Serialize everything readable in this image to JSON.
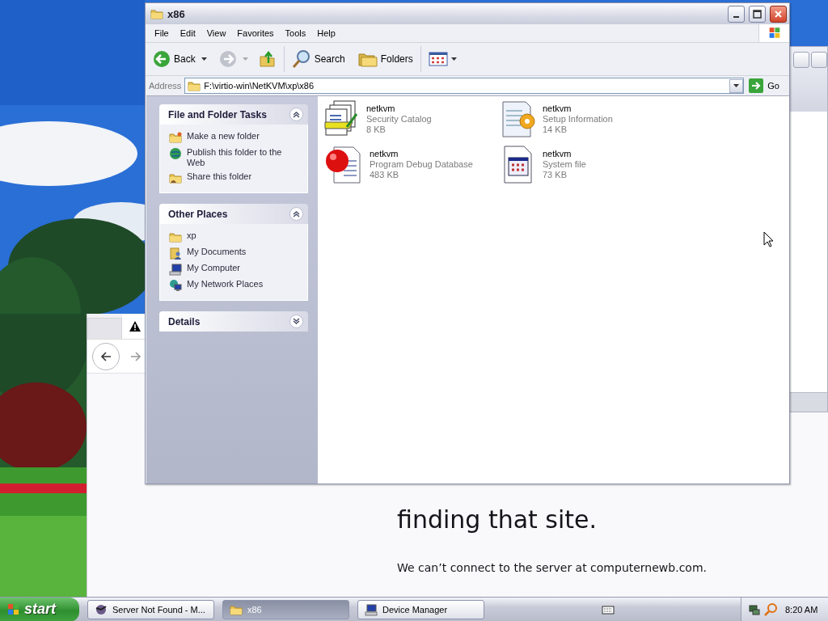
{
  "browser_window": {
    "heading_lines": [
      "finding that site."
    ],
    "message": "We can’t connect to the server at computernewb.com."
  },
  "explorer": {
    "title": "x86",
    "menu": [
      "File",
      "Edit",
      "View",
      "Favorites",
      "Tools",
      "Help"
    ],
    "toolbar": {
      "back": "Back",
      "search": "Search",
      "folders": "Folders"
    },
    "address": {
      "label": "Address",
      "value": "F:\\virtio-win\\NetKVM\\xp\\x86",
      "go": "Go"
    },
    "panels": [
      {
        "title": "File and Folder Tasks",
        "expanded": true,
        "items": [
          {
            "label": "Make a new folder",
            "kind": "new-folder"
          },
          {
            "label": "Publish this folder to the Web",
            "kind": "globe"
          },
          {
            "label": "Share this folder",
            "kind": "share"
          }
        ]
      },
      {
        "title": "Other Places",
        "expanded": true,
        "items": [
          {
            "label": "xp",
            "kind": "folder"
          },
          {
            "label": "My Documents",
            "kind": "documents"
          },
          {
            "label": "My Computer",
            "kind": "computer"
          },
          {
            "label": "My Network Places",
            "kind": "network"
          }
        ]
      },
      {
        "title": "Details",
        "expanded": false
      }
    ],
    "files": [
      {
        "name": "netkvm",
        "type": "Security Catalog",
        "size": "8 KB",
        "kind": "catalog"
      },
      {
        "name": "netkvm",
        "type": "Setup Information",
        "size": "14 KB",
        "kind": "setup"
      },
      {
        "name": "netkvm",
        "type": "Program Debug Database",
        "size": "483 KB",
        "kind": "debug"
      },
      {
        "name": "netkvm",
        "type": "System file",
        "size": "73 KB",
        "kind": "system"
      }
    ]
  },
  "taskbar": {
    "start": "start",
    "tasks": [
      {
        "label": "Server Not Found - M...",
        "kind": "browser",
        "selected": false
      },
      {
        "label": "x86",
        "kind": "folder",
        "selected": true
      },
      {
        "label": "Device Manager",
        "kind": "device",
        "selected": false
      }
    ],
    "clock": "8:20 AM"
  }
}
